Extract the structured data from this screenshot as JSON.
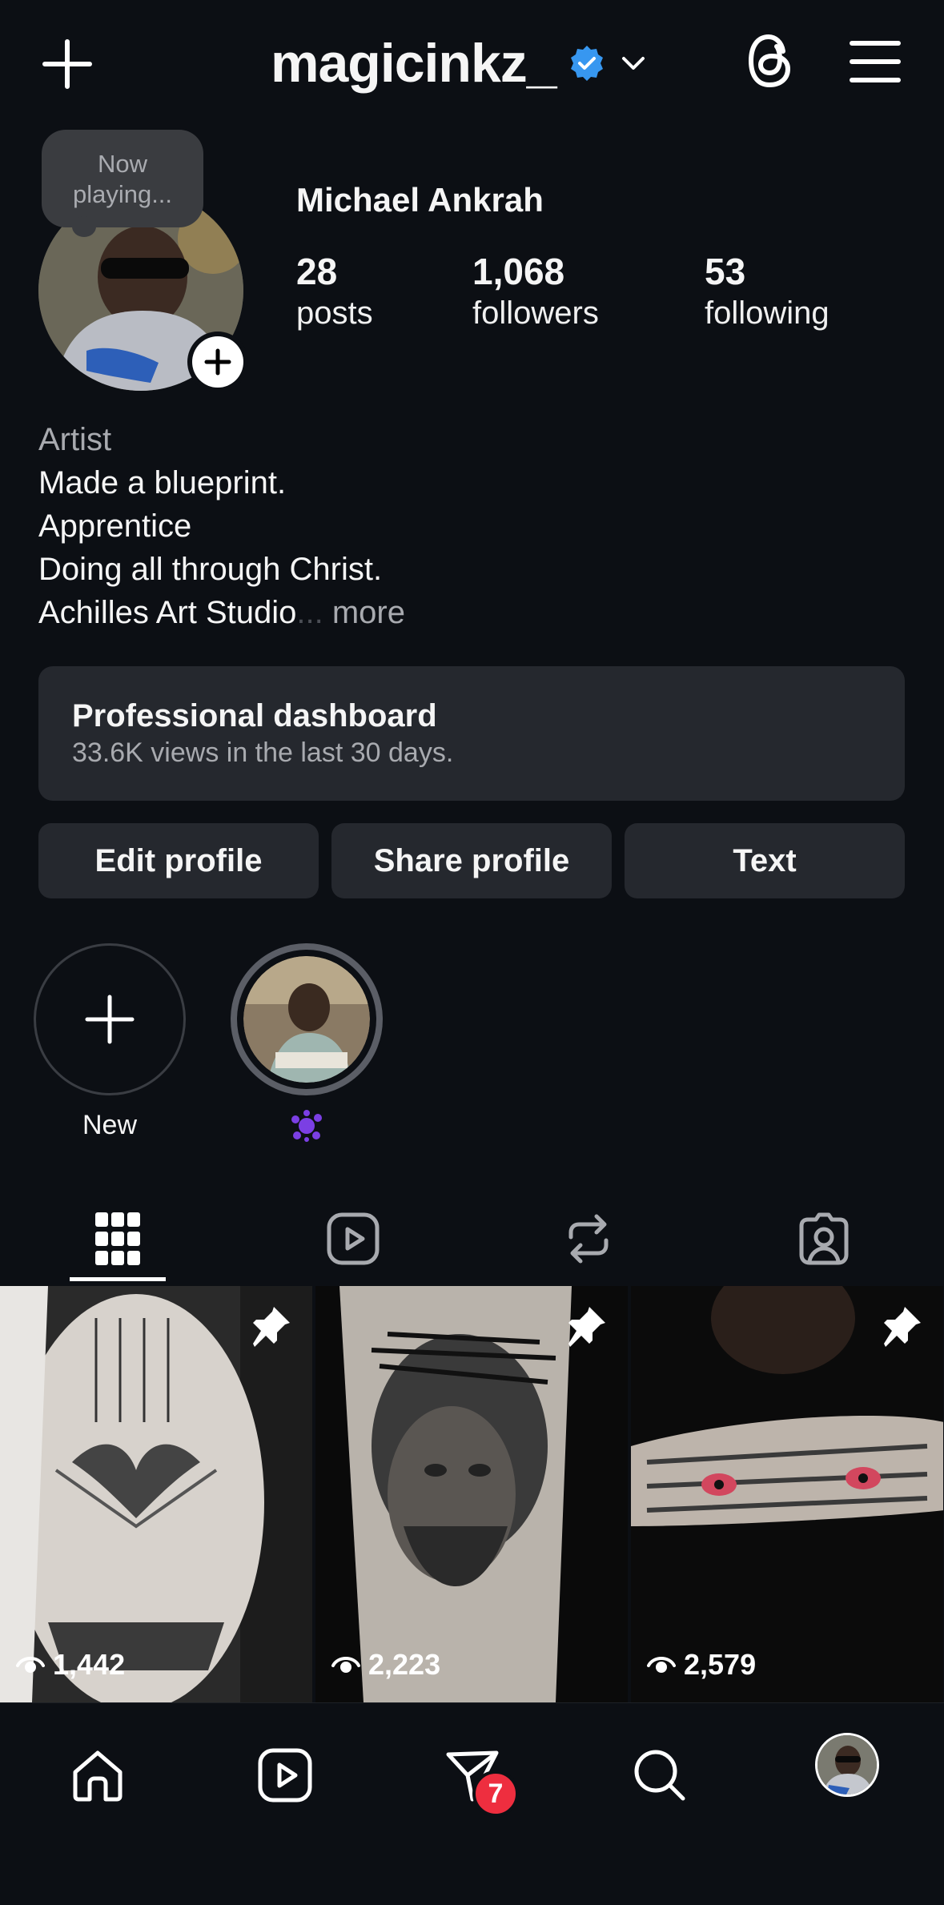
{
  "header": {
    "username": "magicinkz_",
    "verified": true,
    "icons": {
      "create": "plus-icon",
      "verified": "verified-badge-icon",
      "switch_account": "chevron-down-icon",
      "threads": "threads-icon",
      "menu": "hamburger-menu-icon"
    }
  },
  "profile": {
    "note": "Now playing...",
    "full_name": "Michael Ankrah",
    "stats": [
      {
        "value": "28",
        "label": "posts"
      },
      {
        "value": "1,068",
        "label": "followers"
      },
      {
        "value": "53",
        "label": "following"
      }
    ],
    "bio": {
      "category": "Artist",
      "lines": [
        "Made a blueprint.",
        "Apprentice",
        "Doing all through Christ."
      ],
      "last_line": "Achilles Art Studio",
      "ellipsis": "...",
      "more_label": "more"
    }
  },
  "dashboard": {
    "title": "Professional dashboard",
    "subtitle": "33.6K views in the last 30 days."
  },
  "actions": {
    "edit_label": "Edit profile",
    "share_label": "Share profile",
    "text_label": "Text"
  },
  "highlights": [
    {
      "label": "New",
      "type": "new"
    },
    {
      "label": "",
      "type": "story",
      "emoji": "purple-splat-icon"
    }
  ],
  "tabs": [
    {
      "name": "posts-grid",
      "icon": "grid-icon",
      "active": true
    },
    {
      "name": "reels",
      "icon": "reels-icon",
      "active": false
    },
    {
      "name": "reposts",
      "icon": "repost-icon",
      "active": false
    },
    {
      "name": "tagged",
      "icon": "tagged-icon",
      "active": false
    }
  ],
  "posts": [
    {
      "views": "1,442",
      "pinned": true,
      "subject": "dove tattoo"
    },
    {
      "views": "2,223",
      "pinned": true,
      "subject": "jesus portrait tattoo"
    },
    {
      "views": "2,579",
      "pinned": true,
      "subject": "tiger eyes tattoo"
    }
  ],
  "bottom_nav": {
    "items": [
      "home-icon",
      "reels-icon",
      "activity-icon",
      "search-icon",
      "profile-avatar"
    ],
    "activity_badge": "7"
  },
  "colors": {
    "background": "#0c0f14",
    "surface": "#25282e",
    "verified_blue": "#3797f0",
    "badge_red": "#ee2e3f",
    "muted_text": "#a8aaaf"
  }
}
